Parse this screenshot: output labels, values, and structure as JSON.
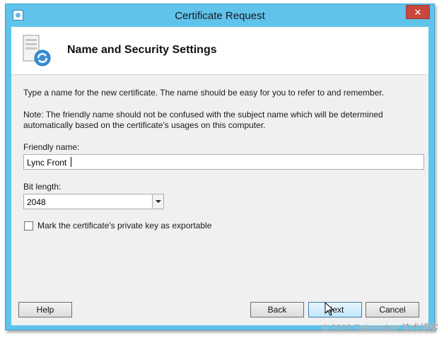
{
  "window": {
    "title": "Certificate Request",
    "close_symbol": "✕"
  },
  "header": {
    "title": "Name and Security Settings"
  },
  "content": {
    "instruction": "Type a name for the new certificate. The name should be easy for you to refer to and remember.",
    "note_line1": "Note: The friendly name should not be confused with the subject name which will be determined",
    "note_line2": "automatically based on the certificate's usages on this computer.",
    "friendly_name_label": "Friendly name:",
    "friendly_name_value": "Lync Front",
    "bit_length_label": "Bit length:",
    "bit_length_value": "2048",
    "exportable_label": "Mark the certificate's private key as exportable",
    "exportable_checked": false
  },
  "buttons": {
    "help": "Help",
    "back": "Back",
    "next": "Next",
    "cancel": "Cancel"
  },
  "watermark": "© 2012 Reinember 技术博客",
  "colors": {
    "titlebar": "#5fc3ec",
    "close_button": "#c9463d",
    "client_background": "#f0f0f0"
  }
}
